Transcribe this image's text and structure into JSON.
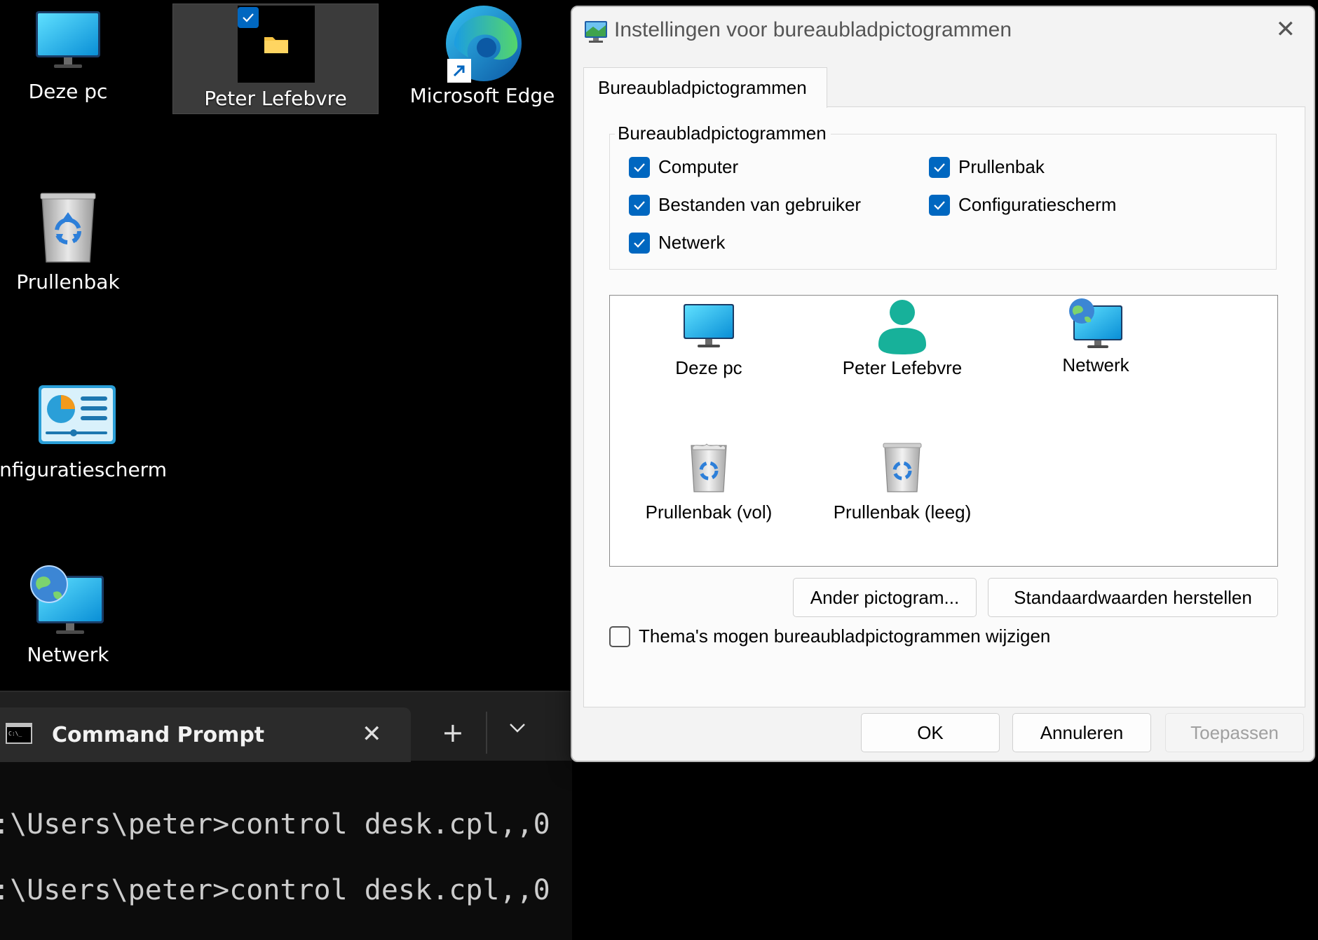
{
  "desktop": {
    "icons": [
      {
        "label": "Deze pc",
        "icon": "monitor-icon"
      },
      {
        "label": "Peter Lefebvre",
        "icon": "folder-icon",
        "selected": true
      },
      {
        "label": "Microsoft Edge",
        "icon": "edge-icon"
      },
      {
        "label": "Prullenbak",
        "icon": "recycle-bin-icon"
      },
      {
        "label": "onfiguratiescherm",
        "icon": "control-panel-icon"
      },
      {
        "label": "Netwerk",
        "icon": "network-icon"
      }
    ]
  },
  "terminal": {
    "tab_title": "Command Prompt",
    "lines": [
      ":\\Users\\peter>control desk.cpl,,0",
      ":\\Users\\peter>control desk.cpl,,0"
    ]
  },
  "dialog": {
    "title": "Instellingen voor bureaubladpictogrammen",
    "tab_label": "Bureaubladpictogrammen",
    "group_label": "Bureaubladpictogrammen",
    "checkboxes": [
      {
        "label": "Computer",
        "checked": true
      },
      {
        "label": "Prullenbak",
        "checked": true
      },
      {
        "label": "Bestanden van gebruiker",
        "checked": true
      },
      {
        "label": "Configuratiescherm",
        "checked": true
      },
      {
        "label": "Netwerk",
        "checked": true
      }
    ],
    "icon_list": [
      {
        "label": "Deze pc",
        "icon": "monitor-icon"
      },
      {
        "label": "Peter Lefebvre",
        "icon": "user-icon"
      },
      {
        "label": "Netwerk",
        "icon": "network-icon"
      },
      {
        "label": "Prullenbak (vol)",
        "icon": "recycle-bin-full-icon"
      },
      {
        "label": "Prullenbak (leeg)",
        "icon": "recycle-bin-empty-icon"
      }
    ],
    "change_icon_button": "Ander pictogram...",
    "restore_defaults_button": "Standaardwaarden herstellen",
    "theme_checkbox": {
      "label": "Thema's mogen bureaubladpictogrammen wijzigen",
      "checked": false
    },
    "ok_button": "OK",
    "cancel_button": "Annuleren",
    "apply_button": "Toepassen"
  },
  "colors": {
    "accent": "#0067c0",
    "desktop_bg": "#000000",
    "dialog_bg": "#f3f3f3"
  }
}
